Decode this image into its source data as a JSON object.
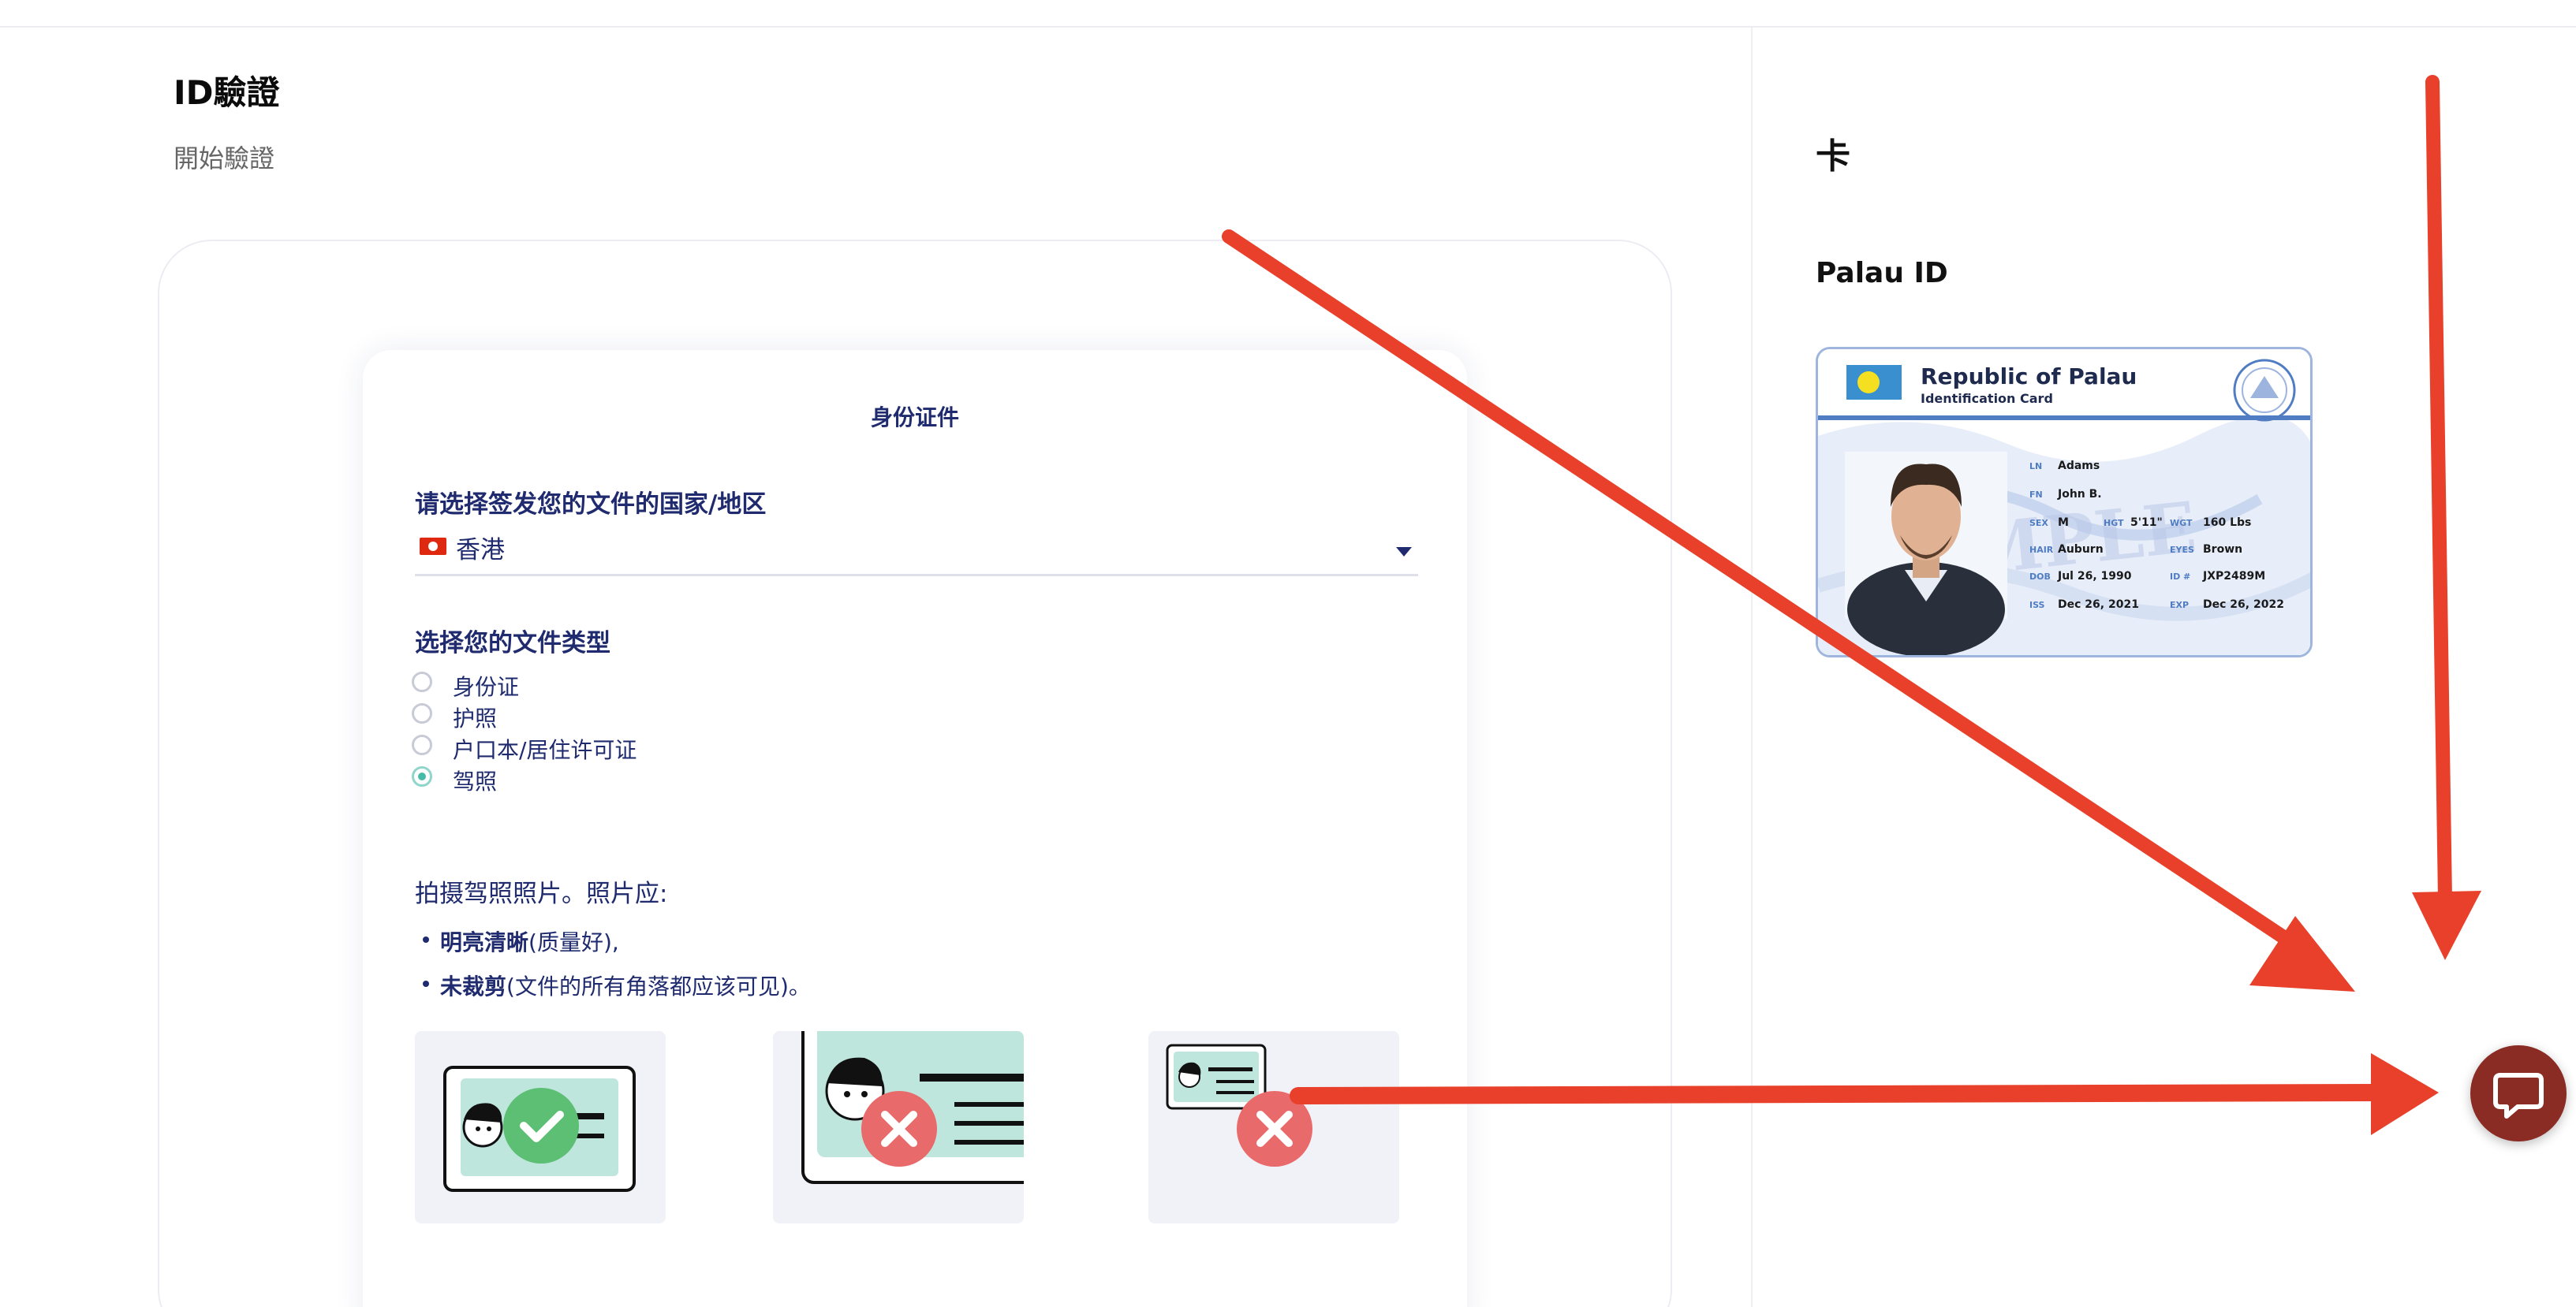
{
  "header": {
    "title": "ID驗證",
    "subtitle": "開始驗證"
  },
  "form": {
    "heading": "身份证件",
    "country_question": "请选择签发您的文件的国家/地区",
    "country_value": "香港",
    "doc_type_question": "选择您的文件类型",
    "doc_types": [
      {
        "label": "身份证",
        "checked": false
      },
      {
        "label": "护照",
        "checked": false
      },
      {
        "label": "户口本/居住许可证",
        "checked": false
      },
      {
        "label": "驾照",
        "checked": true
      }
    ],
    "photo_heading": "拍摄驾照照片。照片应:",
    "requirements": [
      {
        "bold": "明亮清晰",
        "rest": "(质量好),"
      },
      {
        "bold": "未裁剪",
        "rest": "(文件的所有角落都应该可见)。"
      }
    ],
    "examples": [
      {
        "status": "ok"
      },
      {
        "status": "bad"
      },
      {
        "status": "bad"
      }
    ]
  },
  "sidebar": {
    "card_label": "卡",
    "id_type": "Palau ID",
    "sample": {
      "country": "Republic of Palau",
      "card_type": "Identification Card",
      "watermark": "SAMPLE",
      "fields": [
        {
          "key": "LN",
          "value": "Adams"
        },
        {
          "key": "FN",
          "value": "John B."
        },
        {
          "key": "SEX",
          "value": "M"
        },
        {
          "key": "HGT",
          "value": "5'11\""
        },
        {
          "key": "WGT",
          "value": "160 Lbs"
        },
        {
          "key": "HAIR",
          "value": "Auburn"
        },
        {
          "key": "EYES",
          "value": "Brown"
        },
        {
          "key": "DOB",
          "value": "Jul 26, 1990"
        },
        {
          "key": "ID #",
          "value": "JXP2489M"
        },
        {
          "key": "ISS",
          "value": "Dec 26, 2021"
        },
        {
          "key": "EXP",
          "value": "Dec 26, 2022"
        }
      ]
    }
  },
  "colors": {
    "navy": "#1f2b6e",
    "teal": "#48bba8",
    "mint": "#bfe6dd",
    "error": "#e86a6a",
    "ok": "#5cbf74",
    "annotation_red": "#e8402a",
    "chat_bg": "#8a2b24"
  },
  "icons": {
    "chevron": "chevron-down-icon",
    "chat": "chat-bubble-icon",
    "check": "check-icon",
    "cross": "close-icon"
  }
}
